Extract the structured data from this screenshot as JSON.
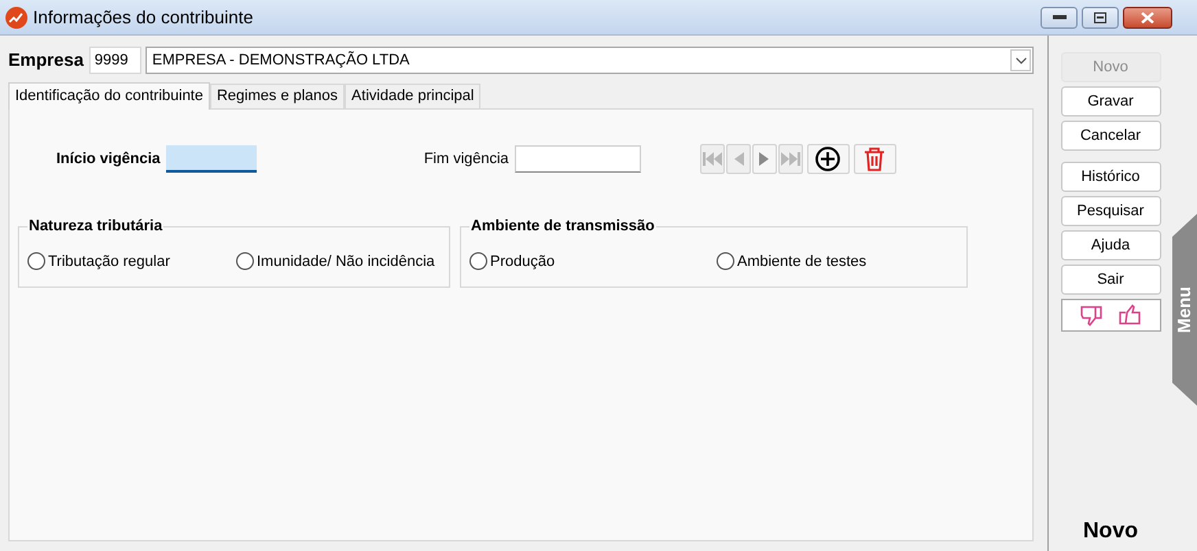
{
  "window": {
    "title": "Informações do contribuinte"
  },
  "empresa": {
    "label": "Empresa",
    "code": "9999",
    "name": "EMPRESA - DEMONSTRAÇÃO LTDA"
  },
  "tabs": [
    {
      "label": "Identificação do contribuinte",
      "selected": true
    },
    {
      "label": "Regimes e planos",
      "selected": false
    },
    {
      "label": "Atividade principal",
      "selected": false
    }
  ],
  "inicio_vigencia": {
    "label": "Início vigência"
  },
  "fim_vigencia": {
    "label": "Fim vigência"
  },
  "nav_buttons": [
    {
      "kind": "first",
      "disabled": true
    },
    {
      "kind": "prev",
      "disabled": true
    },
    {
      "kind": "next",
      "disabled": false
    },
    {
      "kind": "last",
      "disabled": true
    },
    {
      "kind": "add",
      "disabled": false
    },
    {
      "kind": "delete",
      "disabled": false
    }
  ],
  "groups": [
    {
      "title": "Natureza tributária",
      "options": [
        {
          "label": "Tributação regular",
          "selected": false
        },
        {
          "label": "Imunidade/ Não incidência",
          "selected": false
        }
      ]
    },
    {
      "title": "Ambiente de transmissão",
      "options": [
        {
          "label": "Produção",
          "selected": false
        },
        {
          "label": "Ambiente de testes",
          "selected": false
        }
      ]
    }
  ],
  "action_groups": [
    [
      {
        "label": "Novo",
        "disabled": true
      },
      {
        "label": "Gravar",
        "disabled": false
      },
      {
        "label": "Cancelar",
        "disabled": false
      }
    ],
    [
      {
        "label": "Histórico",
        "disabled": false
      },
      {
        "label": "Pesquisar",
        "disabled": false
      },
      {
        "label": "Ajuda",
        "disabled": false
      },
      {
        "label": "Sair",
        "disabled": false
      }
    ]
  ],
  "menu_tab": "Menu",
  "status": "Novo"
}
